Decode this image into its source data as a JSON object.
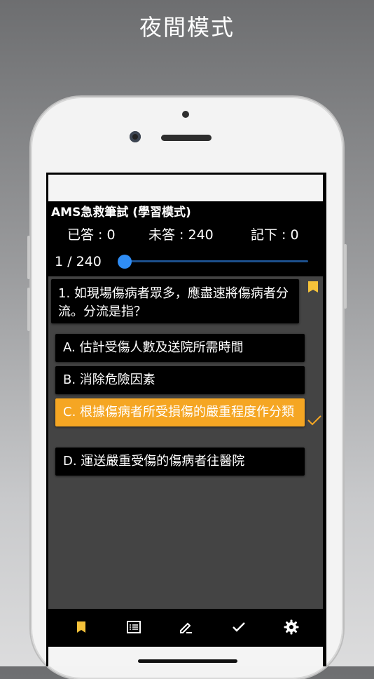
{
  "banner": {
    "title": "夜間模式"
  },
  "app": {
    "title": "AMS急救筆試 (學習模式)",
    "counts": {
      "answered": "已答 : 0",
      "unanswered": "未答 : 240",
      "marked": "記下 : 0"
    },
    "progress": {
      "label": "1 / 240",
      "current": 1,
      "total": 240
    }
  },
  "question": {
    "text": "1. 如現場傷病者眾多，應盡速將傷病者分流。分流是指？"
  },
  "options": [
    {
      "text": "A. 估計受傷人數及送院所需時間",
      "selected": false
    },
    {
      "text": "B. 消除危險因素",
      "selected": false
    },
    {
      "text": "C. 根據傷病者所受損傷的嚴重程度作分類",
      "selected": true
    },
    {
      "text": "D. 運送嚴重受傷的傷病者往醫院",
      "selected": false
    }
  ],
  "colors": {
    "accent": "#f5a623",
    "slider": "#2f8df5",
    "background": "#000000",
    "panel": "#444444"
  },
  "bottom_nav": {
    "items": [
      "bookmark-icon",
      "list-icon",
      "edit-icon",
      "check-icon",
      "gear-icon"
    ],
    "active": "bookmark-icon"
  }
}
